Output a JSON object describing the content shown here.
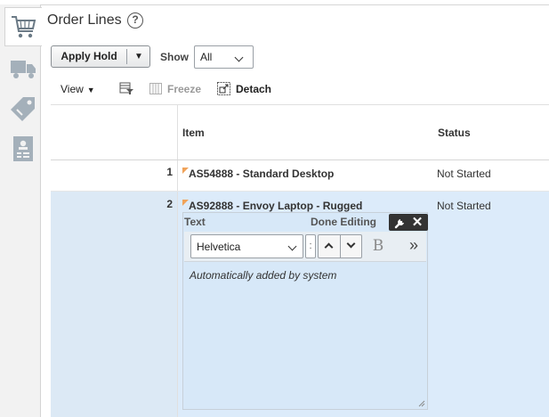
{
  "header": {
    "title": "Order Lines",
    "help_glyph": "?"
  },
  "rail": {
    "items": [
      {
        "name": "cart-icon",
        "selected": true
      },
      {
        "name": "truck-icon",
        "selected": false
      },
      {
        "name": "price-tag-icon",
        "selected": false
      },
      {
        "name": "contact-card-icon",
        "selected": false
      }
    ]
  },
  "toolbar": {
    "apply_hold_label": "Apply Hold",
    "apply_hold_caret": "▼",
    "show_label": "Show",
    "show_value": "All",
    "view_label": "View",
    "view_arrow": "▼",
    "freeze_label": "Freeze",
    "detach_label": "Detach"
  },
  "table": {
    "columns": [
      "Item",
      "Status"
    ],
    "rows": [
      {
        "num": "1",
        "item": "AS54888 - Standard Desktop",
        "status": "Not Started",
        "selected": false
      },
      {
        "num": "2",
        "item": "AS92888 - Envoy Laptop - Rugged",
        "status": "Not Started",
        "selected": true
      }
    ]
  },
  "editor": {
    "label": "Text",
    "done_label": "Done Editing",
    "close_glyph": "✕",
    "font_value": "Helvetica",
    "size_value": ":",
    "bold_glyph": "B",
    "more_glyph": "»",
    "content": "Automatically added by system"
  },
  "colors": {
    "selected_row": "#dcebfa",
    "flag": "#f0a35a",
    "tools_bg": "#333333"
  }
}
